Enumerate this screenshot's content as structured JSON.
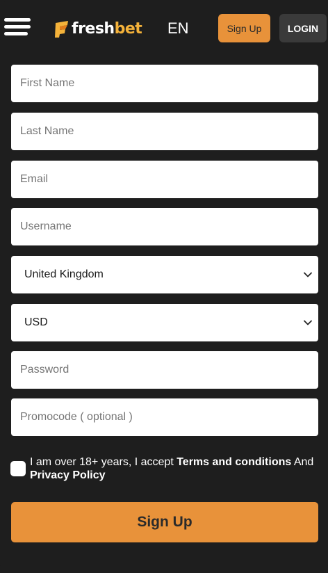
{
  "header": {
    "logo_text_part1": "fresh",
    "logo_text_part2": "bet",
    "language": "EN",
    "signup_label": "Sign Up",
    "login_label": "LOGIN"
  },
  "form": {
    "first_name_placeholder": "First Name",
    "last_name_placeholder": "Last Name",
    "email_placeholder": "Email",
    "username_placeholder": "Username",
    "country_value": "United Kingdom",
    "currency_value": "USD",
    "password_placeholder": "Password",
    "promocode_placeholder": "Promocode ( optional )",
    "terms_prefix": "I am over 18+ years, I accept ",
    "terms_link": "Terms and conditions",
    "terms_middle": " And ",
    "privacy_link": "Privacy Policy",
    "submit_label": "Sign Up"
  },
  "colors": {
    "background": "#1e1e1e",
    "accent_orange": "#e8923a",
    "logo_gold": "#f4b23a",
    "login_button": "#3a3a3a",
    "field_bg": "#ffffff"
  },
  "icons": {
    "menu": "hamburger-icon",
    "logo_mark": "freshbet-logo-mark",
    "select_arrow": "chevron-down-icon"
  }
}
